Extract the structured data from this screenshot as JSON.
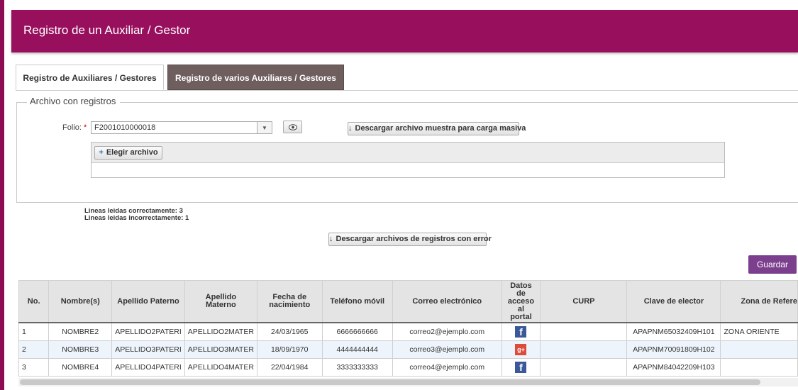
{
  "header": {
    "title": "Registro de un Auxiliar / Gestor"
  },
  "tabs": [
    {
      "label": "Registro de Auxiliares / Gestores",
      "active": true
    },
    {
      "label": "Registro de varios Auxiliares / Gestores",
      "active": false
    }
  ],
  "fieldset": {
    "legend": "Archivo con registros"
  },
  "folio": {
    "label": "Folio:",
    "required_mark": "*",
    "value": "F2001010000018"
  },
  "buttons": {
    "download_sample": "Descargar archivo muestra para carga masiva",
    "choose_file": "Elegir archivo",
    "download_errors": "Descargar archivos de registros con error",
    "save": "Guardar"
  },
  "stats": {
    "ok": "Lineas leidas correctamente: 3",
    "bad": "Lineas leidas incorrectamente: 1"
  },
  "table": {
    "columns": [
      "No.",
      "Nombre(s)",
      "Apellido Paterno",
      "Apellido Materno",
      "Fecha de nacimiento",
      "Teléfono móvil",
      "Correo electrónico",
      "Datos de acceso al portal",
      "CURP",
      "Clave de elector",
      "Zona de Refere"
    ],
    "rows": [
      {
        "no": "1",
        "nombre": "NOMBRE2",
        "paterno": "APELLIDO2PATERI",
        "materno": "APELLIDO2MATER",
        "fecha": "24/03/1965",
        "telefono": "6666666666",
        "correo": "correo2@ejemplo.com",
        "portal": "facebook-icon",
        "curp": "",
        "clave": "APAPNM65032409H101",
        "zona": "ZONA ORIENTE"
      },
      {
        "no": "2",
        "nombre": "NOMBRE3",
        "paterno": "APELLIDO3PATERI",
        "materno": "APELLIDO3MATER",
        "fecha": "18/09/1970",
        "telefono": "4444444444",
        "correo": "correo3@ejemplo.com",
        "portal": "google-plus-icon",
        "curp": "",
        "clave": "APAPNM70091809H102",
        "zona": ""
      },
      {
        "no": "3",
        "nombre": "NOMBRE4",
        "paterno": "APELLIDO4PATERI",
        "materno": "APELLIDO4MATER",
        "fecha": "22/04/1984",
        "telefono": "3333333333",
        "correo": "correo4@ejemplo.com",
        "portal": "facebook-icon",
        "curp": "",
        "clave": "APAPNM84042209H103",
        "zona": ""
      }
    ]
  },
  "colors": {
    "brand": "#970f5d",
    "save": "#7c3f8e",
    "tab_inactive": "#6e5e5e"
  }
}
